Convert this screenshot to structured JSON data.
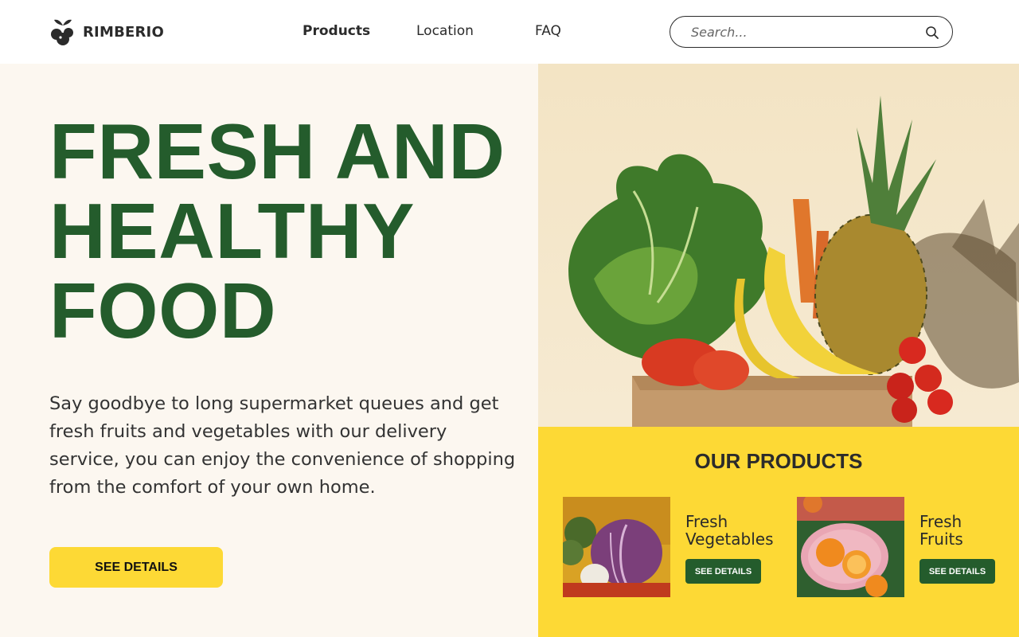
{
  "header": {
    "brand": "RIMBERIO",
    "nav": [
      {
        "label": "Products"
      },
      {
        "label": "Location"
      },
      {
        "label": "FAQ"
      }
    ],
    "search": {
      "placeholder": "Search...",
      "icon": "search-icon"
    }
  },
  "hero": {
    "title_lines": [
      "FRESH AND",
      "HEALTHY",
      "FOOD"
    ],
    "description": "Say goodbye to long supermarket queues and get fresh fruits and vegetables with our delivery service, you can enjoy the convenience of shopping from the comfort of your own home.",
    "cta_label": "SEE DETAILS"
  },
  "products": {
    "title": "OUR PRODUCTS",
    "items": [
      {
        "title_line1": "Fresh",
        "title_line2": "Vegetables",
        "button_label": "SEE DETAILS"
      },
      {
        "title_line1": "Fresh",
        "title_line2": "Fruits",
        "button_label": "SEE DETAILS"
      }
    ]
  },
  "colors": {
    "brand_green": "#245c2c",
    "accent_yellow": "#fdd935",
    "hero_bg": "#fcf7f0"
  }
}
